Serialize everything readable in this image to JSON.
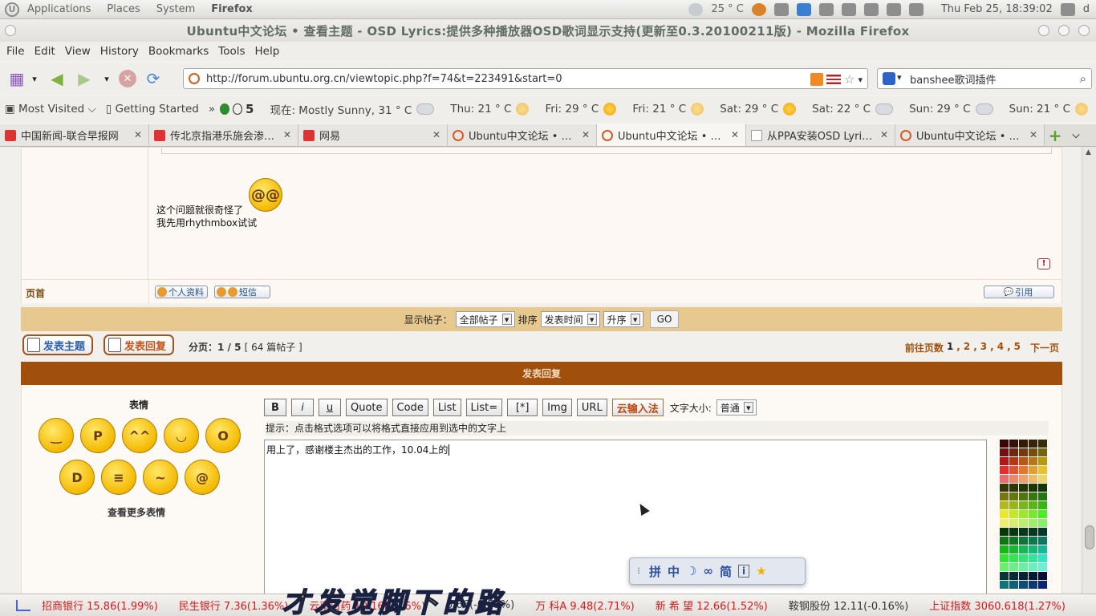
{
  "panel": {
    "menus": [
      "Applications",
      "Places",
      "System"
    ],
    "active_app": "Firefox",
    "temperature": "25 ° C",
    "datetime": "Thu Feb 25, 18:39:02",
    "user": "d"
  },
  "window": {
    "title": "Ubuntu中文论坛 • 查看主题 - OSD Lyrics:提供多种播放器OSD歌词显示支持(更新至0.3.20100211版) - Mozilla Firefox"
  },
  "menubar": [
    "File",
    "Edit",
    "View",
    "History",
    "Bookmarks",
    "Tools",
    "Help"
  ],
  "navbar": {
    "url": "http://forum.ubuntu.org.cn/viewtopic.php?f=74&t=223491&start=0",
    "search_value": "banshee歌词插件"
  },
  "bookmarks": {
    "items": [
      "Most Visited",
      "Getting Started"
    ],
    "overflow": "»",
    "counter": "5",
    "weather": [
      {
        "label": "现在: Mostly Sunny, 31 ° C",
        "icon": "partly-cloudy-icon"
      },
      {
        "label": "Thu: 21 ° C",
        "icon": "moon-icon"
      },
      {
        "label": "Fri: 29 ° C",
        "icon": "sun-icon"
      },
      {
        "label": "Fri: 21 ° C",
        "icon": "moon-icon"
      },
      {
        "label": "Sat: 29 ° C",
        "icon": "sun-icon"
      },
      {
        "label": "Sat: 22 ° C",
        "icon": "partly-cloudy-icon"
      },
      {
        "label": "Sun: 29 ° C",
        "icon": "partly-cloudy-icon"
      },
      {
        "label": "Sun: 21 ° C",
        "icon": "moon-icon"
      }
    ]
  },
  "tabs": [
    {
      "label": "中国新闻-联合早报网",
      "icon": "red"
    },
    {
      "label": "传北京指港乐施会渗…",
      "icon": "red"
    },
    {
      "label": "网易",
      "icon": "red"
    },
    {
      "label": "Ubuntu中文论坛 • …",
      "icon": "ubuntu"
    },
    {
      "label": "Ubuntu中文论坛 • …",
      "icon": "ubuntu",
      "active": true
    },
    {
      "label": "从PPA安装OSD Lyri…",
      "icon": "doc"
    },
    {
      "label": "Ubuntu中文论坛 • …",
      "icon": "ubuntu"
    }
  ],
  "post": {
    "text_line1": "这个问题就很奇怪了",
    "text_line2": "我先用rhythmbox试试",
    "report": "!",
    "home": "页首",
    "profile_btn": "个人资料",
    "pm_btn": "短信",
    "quote_btn": "引用"
  },
  "sortbar": {
    "show_label": "显示帖子：",
    "show_value": "全部帖子",
    "sort_label": "排序",
    "sort_value": "发表时间",
    "order_value": "升序",
    "go": "GO"
  },
  "actions": {
    "new_topic": "发表主题",
    "reply": "发表回复",
    "page_label": "分页：",
    "page_value": "1 / 5",
    "post_count": "[ 64 篇帖子 ]",
    "goto_label": "前往页数",
    "pages": [
      "1",
      "2",
      "3",
      "4",
      "5"
    ],
    "next": "下一页"
  },
  "reply": {
    "header": "发表回复",
    "emoticon_title": "表情",
    "more_emoticons": "查看更多表情",
    "format_buttons": [
      "B",
      "i",
      "u",
      "Quote",
      "Code",
      "List",
      "List=",
      "[*]",
      "Img",
      "URL",
      "云输入法"
    ],
    "font_size_label": "文字大小:",
    "font_size_value": "普通",
    "hint": "提示：点击格式选项可以将格式直接应用到选中的文字上",
    "message": "用上了，感谢楼主杰出的工作，10.04上的"
  },
  "ime": {
    "items": [
      "拼",
      "中",
      "☽",
      "∞",
      "简",
      "i",
      "★"
    ]
  },
  "lyrics": "才发觉脚下的路",
  "ticker": [
    {
      "text": "招商银行 15.86(1.99%)",
      "dir": "up"
    },
    {
      "text": "民生银行 7.36(1.36%)",
      "dir": "up"
    },
    {
      "text": "云南白药 10.16(0.16%)",
      "dir": "up"
    },
    {
      "text": "5.66(-0.53%)",
      "dir": "down"
    },
    {
      "text": "万 科A 9.48(2.71%)",
      "dir": "up"
    },
    {
      "text": "新 希 望 12.66(1.52%)",
      "dir": "up"
    },
    {
      "text": "鞍钢股份 12.11(-0.16%)",
      "dir": "down"
    },
    {
      "text": "上证指数 3060.618(1.27%)",
      "dir": "up"
    }
  ]
}
